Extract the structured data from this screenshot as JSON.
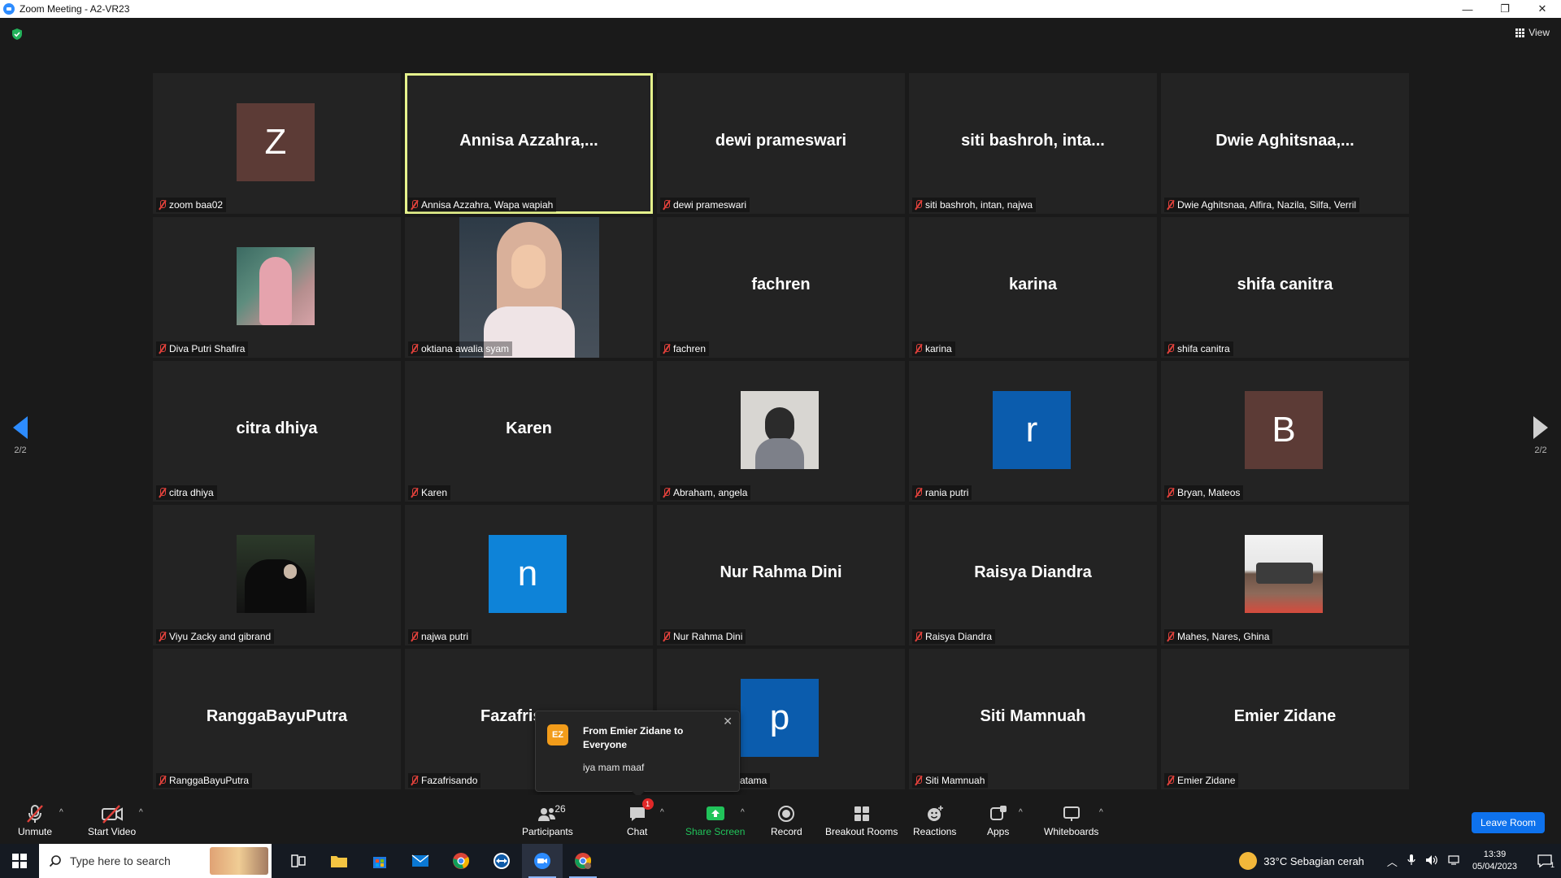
{
  "window": {
    "title": "Zoom Meeting - A2-VR23",
    "minimize": "—",
    "restore": "❐",
    "close": "✕"
  },
  "header": {
    "view_label": "View"
  },
  "pagination": {
    "left": "2/2",
    "right": "2/2"
  },
  "tiles": [
    {
      "label": "zoom baa02",
      "avatar_letter": "Z",
      "avatar_color": "#5c3b36"
    },
    {
      "big": "Annisa  Azzahra,...",
      "label": "Annisa Azzahra, Wapa wapiah"
    },
    {
      "big": "dewi prameswari",
      "label": "dewi prameswari"
    },
    {
      "big": "siti bashroh, inta...",
      "label": "siti bashroh, intan, najwa"
    },
    {
      "big": "Dwie  Aghitsnaa,...",
      "label": "Dwie Aghitsnaa, Alfira, Nazila, Silfa, Verril"
    },
    {
      "label": "Diva Putri Shafira"
    },
    {
      "label": "oktiana awalia syam"
    },
    {
      "big": "fachren",
      "label": "fachren"
    },
    {
      "big": "karina",
      "label": "karina"
    },
    {
      "big": "shifa canitra",
      "label": "shifa canitra"
    },
    {
      "big": "citra dhiya",
      "label": "citra dhiya"
    },
    {
      "big": "Karen",
      "label": "Karen"
    },
    {
      "label": "Abraham, angela"
    },
    {
      "label": "rania putri",
      "avatar_letter": "r",
      "avatar_color": "#0b5cad"
    },
    {
      "label": "Bryan, Mateos",
      "avatar_letter": "B",
      "avatar_color": "#5c3b36"
    },
    {
      "label": "Viyu Zacky and gibrand"
    },
    {
      "label": "najwa putri",
      "avatar_letter": "n",
      "avatar_color": "#0e83d8"
    },
    {
      "big": "Nur Rahma Dini",
      "label": "Nur Rahma Dini"
    },
    {
      "big": "Raisya Diandra",
      "label": "Raisya Diandra"
    },
    {
      "label": "Mahes, Nares, Ghina"
    },
    {
      "big": "RanggaBayuPutra",
      "label": "RanggaBayuPutra"
    },
    {
      "big": "Fazafris",
      "label": "Fazafrisando"
    },
    {
      "label": "ratama",
      "avatar_letter": "p",
      "avatar_color": "#0b5cad"
    },
    {
      "big": "Siti Mamnuah",
      "label": "Siti Mamnuah"
    },
    {
      "big": "Emier Zidane",
      "label": "Emier Zidane"
    }
  ],
  "toast": {
    "initials": "EZ",
    "from": "From Emier Zidane to Everyone",
    "message": "iya mam maaf",
    "close": "✕"
  },
  "toolbar": {
    "unmute": "Unmute",
    "start_video": "Start Video",
    "participants": "Participants",
    "participants_count": "26",
    "chat": "Chat",
    "chat_badge": "1",
    "share_screen": "Share Screen",
    "record": "Record",
    "breakout_rooms": "Breakout Rooms",
    "reactions": "Reactions",
    "apps": "Apps",
    "whiteboards": "Whiteboards",
    "leave": "Leave Room",
    "caret": "^"
  },
  "taskbar": {
    "search_placeholder": "Type here to search",
    "weather": "33°C  Sebagian cerah",
    "time": "13:39",
    "date": "05/04/2023",
    "notif_count": "1"
  },
  "colors": {
    "active_border": "#e5f28c",
    "accent": "#2d8cff",
    "leave": "#0e72ed",
    "share_green": "#21c35a"
  }
}
